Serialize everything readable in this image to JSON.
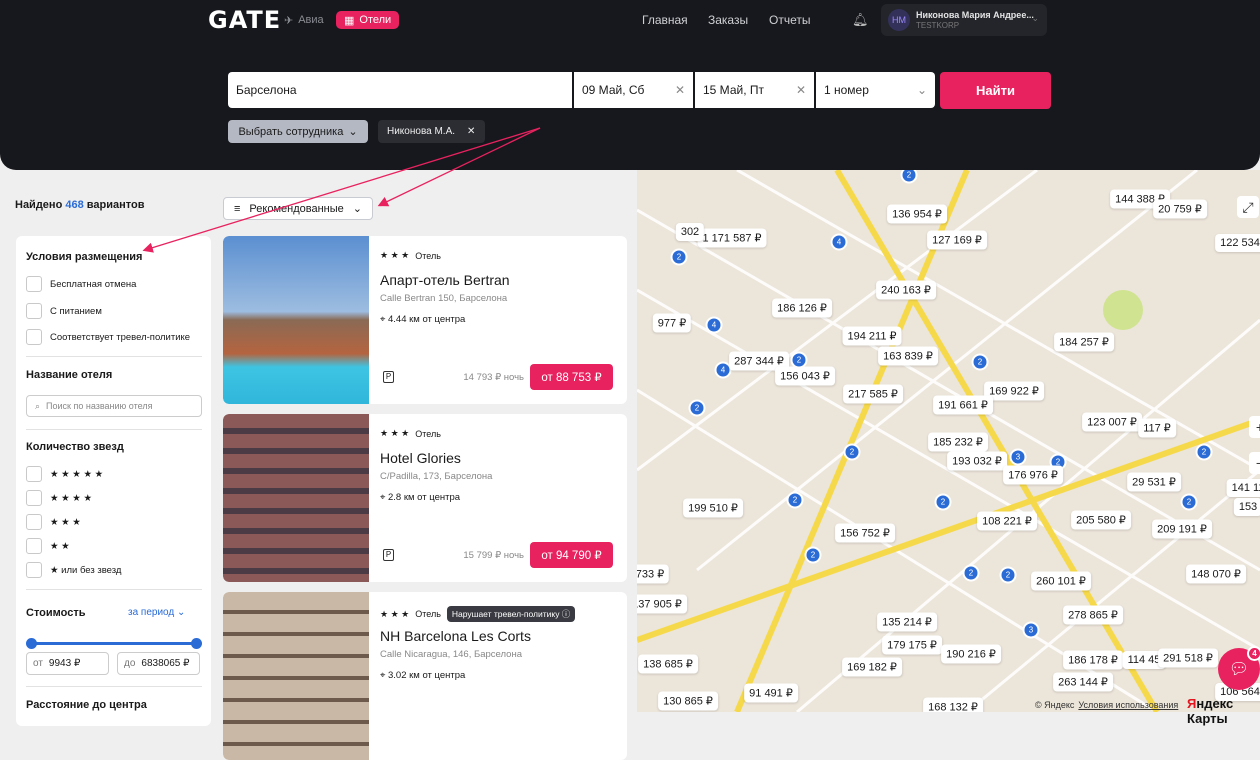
{
  "header": {
    "logo": "GATE",
    "tabs": [
      {
        "label": "Авиа",
        "icon": "plane-icon"
      },
      {
        "label": "Отели",
        "icon": "hotel-icon"
      }
    ],
    "menu": [
      "Главная",
      "Заказы",
      "Отчеты"
    ],
    "user": {
      "initials": "НМ",
      "name": "Никонова Мария Андрее...",
      "company": "TESTKORP"
    }
  },
  "search": {
    "city": "Барселона",
    "checkin": "09 Май, Сб",
    "checkout": "15 Май, Пт",
    "rooms": "1 номер",
    "find": "Найти",
    "employee_button": "Выбрать сотрудника",
    "employee_chip": "Никонова М.А."
  },
  "results": {
    "found_prefix": "Найдено",
    "count": "468",
    "found_suffix": "вариантов",
    "sort": "Рекомендованные"
  },
  "filters": {
    "conditions_title": "Условия размещения",
    "conditions": [
      "Бесплатная отмена",
      "С питанием",
      "Соответствует тревел-политике"
    ],
    "name_title": "Название отеля",
    "name_placeholder": "Поиск по названию отеля",
    "stars_title": "Количество звезд",
    "stars": [
      "★ ★ ★ ★ ★",
      "★ ★ ★ ★",
      "★ ★ ★",
      "★ ★",
      "★  или без звезд"
    ],
    "price_title": "Стоимость",
    "price_period": "за период",
    "price_from_label": "от",
    "price_from": "9943 ₽",
    "price_to_label": "до",
    "price_to": "6838065 ₽",
    "distance_title": "Расстояние до центра"
  },
  "hotels": [
    {
      "stars": "★ ★ ★",
      "type": "Отель",
      "badge": "",
      "name": "Апарт-отель Bertran",
      "address": "Calle Bertran 150, Барселона",
      "distance": "4.44 км от центра",
      "night": "14 793 ₽ ночь",
      "price": "от 88 753 ₽",
      "parking": "P"
    },
    {
      "stars": "★ ★ ★",
      "type": "Отель",
      "badge": "",
      "name": "Hotel Glories",
      "address": "C/Padilla, 173, Барселона",
      "distance": "2.8 км от центра",
      "night": "15 799 ₽ ночь",
      "price": "от 94 790 ₽",
      "parking": "P"
    },
    {
      "stars": "★ ★ ★",
      "type": "Отель",
      "badge": "Нарушает тревел-политику ⓘ",
      "name": "NH Barcelona Les Corts",
      "address": "Calle Nicaragua, 146, Барселона",
      "distance": "3.02 км от центра"
    }
  ],
  "map": {
    "prices": [
      "136 954 ₽",
      "127 169 ₽",
      "1 171 587 ₽",
      "144 388 ₽",
      "20 759 ₽",
      "122 534",
      "240 163 ₽",
      "186 126 ₽",
      "977 ₽",
      "194 211 ₽",
      "184 257 ₽",
      "163 839 ₽",
      "287 344 ₽",
      "156 043 ₽",
      "217 585 ₽",
      "169 922 ₽",
      "191 661 ₽",
      "123 007 ₽",
      "117 ₽",
      "185 232 ₽",
      "193 032 ₽",
      "176 976 ₽",
      "29 531 ₽",
      "199 510 ₽",
      "108 221 ₽",
      "205 580 ₽",
      "209 191 ₽",
      "156 752 ₽",
      "733 ₽",
      "260 101 ₽",
      "148 070 ₽",
      "137 905 ₽",
      "278 865 ₽",
      "135 214 ₽",
      "179 175 ₽",
      "190 216 ₽",
      "138 685 ₽",
      "169 182 ₽",
      "186 178 ₽",
      "114 45",
      "291 518 ₽",
      "263 144 ₽",
      "130 865 ₽",
      "91 491 ₽",
      "168 132 ₽",
      "106 564",
      "302",
      "141 11",
      "153"
    ],
    "clusters": [
      "2",
      "4",
      "2",
      "4",
      "4",
      "2",
      "2",
      "2",
      "3",
      "2",
      "2",
      "2",
      "2",
      "2",
      "2",
      "2",
      "3",
      "2",
      "2"
    ],
    "copyright": "© Яндекс",
    "terms": "Условия использования",
    "brand_a": "Я",
    "brand_b": "ндекс Карты",
    "chat_count": "4",
    "zoom_in": "+",
    "zoom_out": "−"
  }
}
